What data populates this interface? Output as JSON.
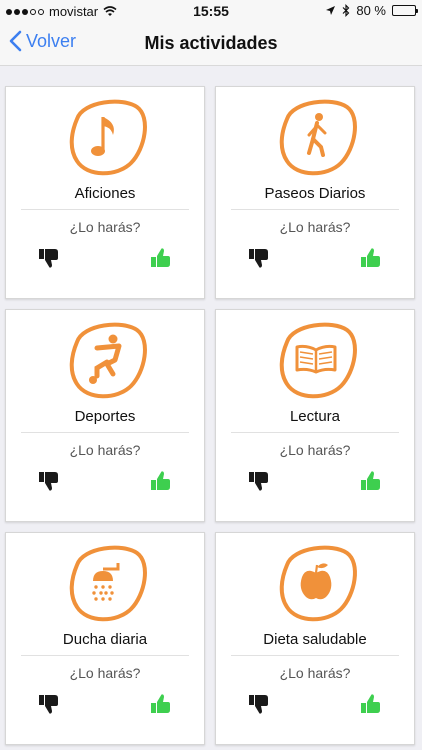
{
  "status_bar": {
    "carrier": "movistar",
    "time": "15:55",
    "battery": "80 %",
    "battery_level": 0.8
  },
  "nav": {
    "back_label": "Volver",
    "title": "Mis actividades"
  },
  "colors": {
    "accent_orange": "#f0913a",
    "thumb_up_green": "#3ecf4f",
    "thumb_down_dark": "#1a1a1a",
    "link_blue": "#3c7ff0"
  },
  "activities": [
    {
      "title": "Aficiones",
      "question": "¿Lo harás?",
      "icon": "music-note-icon"
    },
    {
      "title": "Paseos Diarios",
      "question": "¿Lo harás?",
      "icon": "walking-person-icon"
    },
    {
      "title": "Deportes",
      "question": "¿Lo harás?",
      "icon": "soccer-player-icon"
    },
    {
      "title": "Lectura",
      "question": "¿Lo harás?",
      "icon": "open-book-icon"
    },
    {
      "title": "Ducha diaria",
      "question": "¿Lo harás?",
      "icon": "shower-icon"
    },
    {
      "title": "Dieta saludable",
      "question": "¿Lo harás?",
      "icon": "apple-icon"
    }
  ]
}
